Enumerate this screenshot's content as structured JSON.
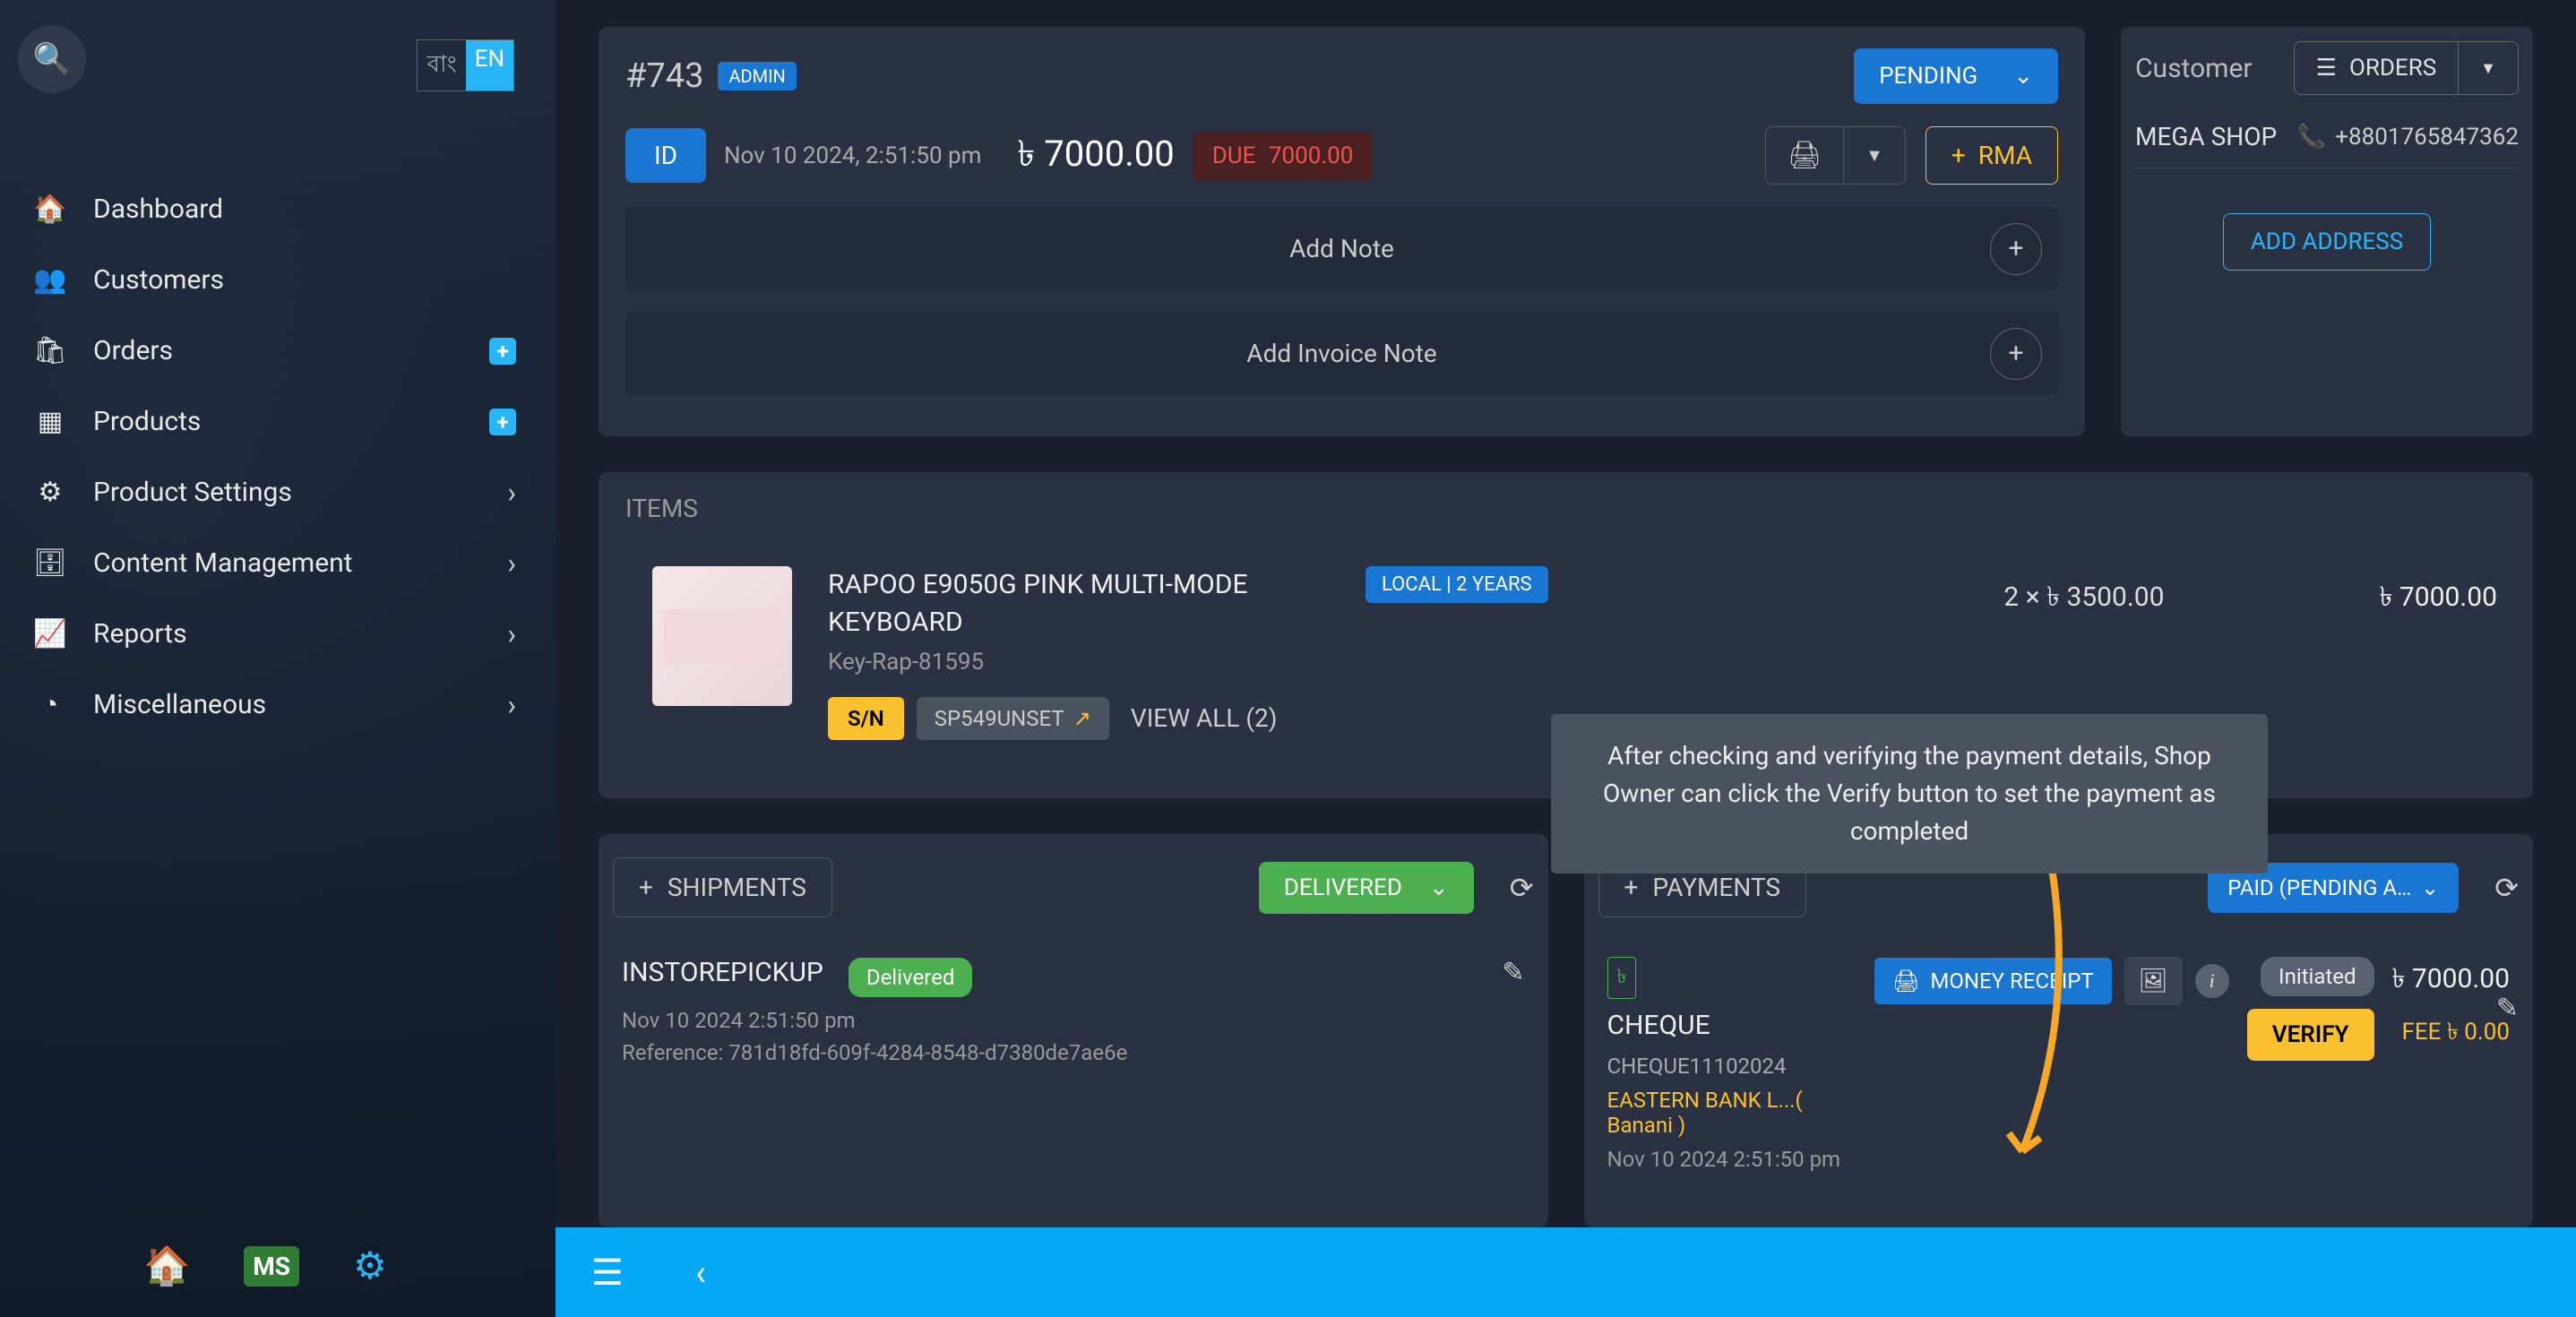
{
  "lang": {
    "bn": "বাং",
    "en": "EN"
  },
  "sidebar": {
    "items": [
      {
        "icon": "🏠",
        "label": "Dashboard"
      },
      {
        "icon": "👥",
        "label": "Customers"
      },
      {
        "icon": "🛍",
        "label": "Orders",
        "plus": true
      },
      {
        "icon": "▦",
        "label": "Products",
        "plus": true
      },
      {
        "icon": "⚙",
        "label": "Product Settings",
        "chevron": true
      },
      {
        "icon": "🗄",
        "label": "Content Management",
        "chevron": true
      },
      {
        "icon": "📈",
        "label": "Reports",
        "chevron": true
      },
      {
        "icon": "◔",
        "label": "Miscellaneous",
        "chevron": true
      }
    ],
    "ms": "MS"
  },
  "order": {
    "id": "#743",
    "admin_badge": "ADMIN",
    "status": "PENDING",
    "id_btn": "ID",
    "date": "Nov 10 2024, 2:51:50 pm",
    "total": "৳ 7000.00",
    "due_label": "DUE",
    "due_amount": "7000.00",
    "rma": "RMA",
    "add_note": "Add Note",
    "add_invoice_note": "Add Invoice Note"
  },
  "customer": {
    "title": "Customer",
    "orders_btn": "ORDERS",
    "shop": "MEGA SHOP",
    "phone": "+8801765847362",
    "add_address": "ADD ADDRESS"
  },
  "items": {
    "heading": "ITEMS",
    "product": {
      "name": "RAPOO E9050G PINK MULTI-MODE KEYBOARD",
      "sku": "Key-Rap-81595",
      "sn": "S/N",
      "sp": "SP549UNSET",
      "view_all": "VIEW ALL (2)",
      "warranty": "LOCAL | 2 YEARS",
      "qty_price": "2 × ৳ 3500.00",
      "line_total": "৳ 7000.00"
    }
  },
  "tooltip": "After checking and verifying the payment details, Shop Owner can click the Verify button to set the payment as completed",
  "shipments": {
    "btn": "SHIPMENTS",
    "status": "DELIVERED",
    "method": "INSTOREPICKUP",
    "badge": "Delivered",
    "date": "Nov 10 2024 2:51:50 pm",
    "reference": "Reference: 781d18fd-609f-4284-8548-d7380de7ae6e"
  },
  "payments": {
    "btn": "PAYMENTS",
    "status": "PAID (PENDING APP...",
    "currency_badge": "৳",
    "method": "CHEQUE",
    "ref": "CHEQUE11102024",
    "bank": "EASTERN BANK L...( Banani )",
    "date": "Nov 10 2024 2:51:50 pm",
    "money_receipt": "MONEY RECEIPT",
    "initiated": "Initiated",
    "verify": "VERIFY",
    "amount": "৳ 7000.00",
    "fee": "FEE ৳ 0.00"
  }
}
